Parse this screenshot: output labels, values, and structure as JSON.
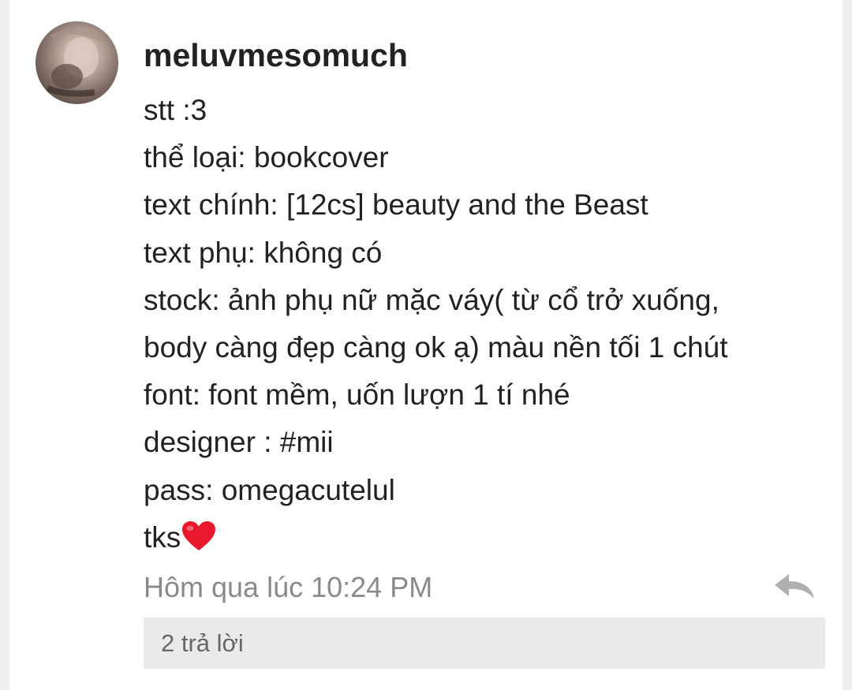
{
  "comment": {
    "username": "meluvmesomuch",
    "lines": [
      "stt :3",
      "thể loại: bookcover",
      "text chính: [12cs] beauty and the Beast",
      "text phụ: không có",
      "stock: ảnh phụ nữ mặc váy( từ cổ trở xuống,",
      "body càng đẹp càng ok ạ) màu nền tối 1 chút",
      "font: font mềm, uốn lượn 1 tí nhé",
      "designer : #mii",
      "pass: omegacutelul",
      "tks"
    ],
    "timestamp": "Hôm qua lúc 10:24 PM",
    "replies_label": "2 trả lời"
  },
  "icons": {
    "avatar": "avatar-photo",
    "heart": "red-heart-emoji",
    "reply": "reply-arrow-icon"
  },
  "colors": {
    "text": "#222222",
    "muted": "#8a8a8a",
    "heart": "#e8192c",
    "reply_icon": "#b0b0b0",
    "replies_bg": "#eaeaea"
  }
}
